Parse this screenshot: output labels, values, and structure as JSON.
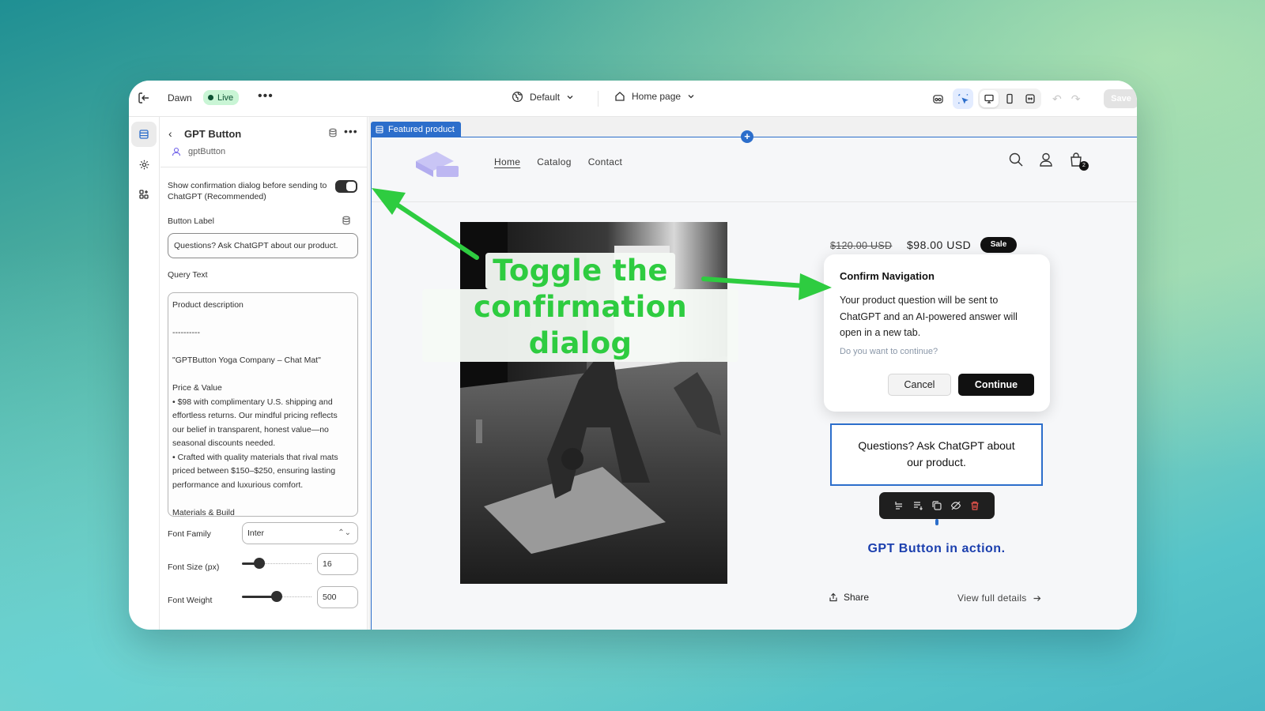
{
  "topbar": {
    "theme_name": "Dawn",
    "live_badge": "Live",
    "more": "•••",
    "template": "Default",
    "page": "Home page",
    "save": "Save"
  },
  "panel": {
    "title": "GPT Button",
    "subtitle": "gptButton",
    "toggle_label": "Show confirmation dialog before sending to ChatGPT (Recommended)",
    "toggle_on": true,
    "button_label_heading": "Button Label",
    "button_label_value": "Questions? Ask ChatGPT about our product.",
    "query_text_heading": "Query Text",
    "query_text_lines": [
      "Product description",
      "",
      "----------",
      "",
      "\"GPTButton Yoga Company – Chat Mat\"",
      "",
      "Price & Value",
      "• $98 with complimentary U.S. shipping and",
      "effortless returns. Our mindful pricing reflects",
      "our belief in transparent, honest value—no",
      "seasonal discounts needed.",
      "• Crafted with quality materials that rival mats",
      "priced between $150–$250, ensuring lasting",
      "performance and luxurious comfort.",
      "",
      "Materials & Build"
    ],
    "font_family_label": "Font Family",
    "font_family_value": "Inter",
    "font_size_label": "Font Size (px)",
    "font_size_value": "16",
    "font_size_fraction": 0.2,
    "font_weight_label": "Font Weight",
    "font_weight_value": "500",
    "font_weight_fraction": 0.5
  },
  "preview": {
    "section_tag": "Featured product",
    "nav": [
      "Home",
      "Catalog",
      "Contact"
    ],
    "cart_count": "2",
    "price_old": "$120.00 USD",
    "price_new": "$98.00 USD",
    "sale_badge": "Sale",
    "dialog": {
      "title": "Confirm Navigation",
      "body": "Your product question will be sent to ChatGPT and an AI-powered answer will open in a new tab.",
      "question": "Do you want to continue?",
      "cancel": "Cancel",
      "continue": "Continue"
    },
    "gpt_button": "Questions? Ask ChatGPT about our product.",
    "caption": "GPT Button in action.",
    "share": "Share",
    "view_full": "View full details"
  },
  "annotation": {
    "line1": "Toggle the",
    "line2": "confirmation dialog",
    "color": "#2ecc40"
  },
  "colors": {
    "accent_blue": "#2c6ecb",
    "live_green": "#c9f5d5",
    "caption_blue": "#1b3fae"
  }
}
